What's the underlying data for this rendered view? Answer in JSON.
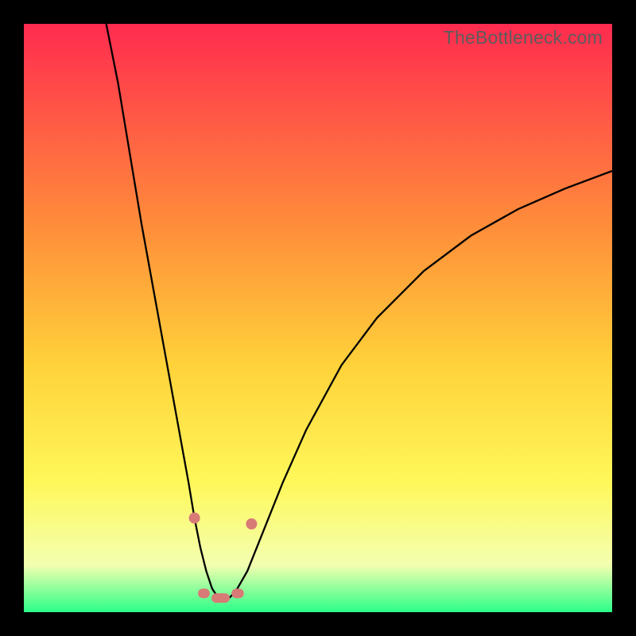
{
  "watermark": "TheBottleneck.com",
  "colors": {
    "gradient_top": "#ff2b4f",
    "gradient_mid1": "#ff8f3a",
    "gradient_mid2": "#ffd23a",
    "gradient_mid3": "#fff85a",
    "gradient_mid4": "#f3ffb0",
    "gradient_bottom": "#2bff88",
    "curve": "#000000",
    "marker": "#d87a76"
  },
  "chart_data": {
    "type": "line",
    "title": "",
    "xlabel": "",
    "ylabel": "",
    "xlim": [
      0,
      100
    ],
    "ylim": [
      0,
      100
    ],
    "series": [
      {
        "name": "bottleneck-curve",
        "x": [
          14,
          16,
          18,
          20,
          22,
          24,
          26,
          28,
          29,
          30,
          31,
          32,
          33,
          34,
          35,
          36,
          38,
          40,
          44,
          48,
          54,
          60,
          68,
          76,
          84,
          92,
          100
        ],
        "y": [
          100,
          90,
          78,
          66,
          55,
          44,
          33,
          22,
          16,
          11,
          7,
          4,
          2.5,
          2.2,
          2.5,
          3.5,
          7,
          12,
          22,
          31,
          42,
          50,
          58,
          64,
          68.5,
          72,
          75
        ]
      }
    ],
    "markers": {
      "left_dot": {
        "x": 29.0,
        "y": 16
      },
      "right_dot": {
        "x": 38.7,
        "y": 15
      },
      "floor_segments": [
        {
          "x0": 29.6,
          "x1": 31.6,
          "y": 3.2
        },
        {
          "x0": 31.9,
          "x1": 35.0,
          "y": 2.4
        },
        {
          "x0": 35.3,
          "x1": 37.4,
          "y": 3.2
        }
      ]
    }
  }
}
